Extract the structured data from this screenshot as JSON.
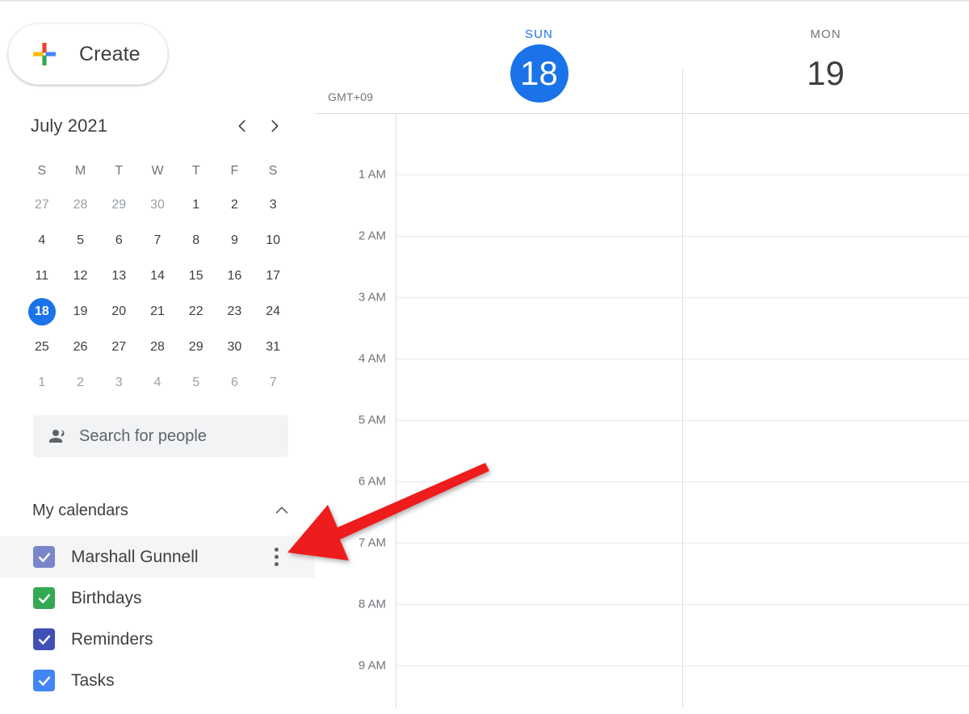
{
  "sidebar": {
    "create_button": {
      "label": "Create",
      "icon": "google-plus-multicolor-icon",
      "colors": {
        "red": "#ea4335",
        "yellow": "#fbbc04",
        "blue": "#4285f4",
        "green": "#34a853"
      }
    },
    "mini_calendar": {
      "title": "July 2021",
      "prev_icon": "chevron-left-icon",
      "next_icon": "chevron-right-icon",
      "weekday_initials": [
        "S",
        "M",
        "T",
        "W",
        "T",
        "F",
        "S"
      ],
      "today": 18,
      "weeks": [
        [
          {
            "n": "27",
            "muted": true
          },
          {
            "n": "28",
            "muted": true
          },
          {
            "n": "29",
            "muted": true
          },
          {
            "n": "30",
            "muted": true
          },
          {
            "n": "1",
            "muted": false
          },
          {
            "n": "2",
            "muted": false
          },
          {
            "n": "3",
            "muted": false
          }
        ],
        [
          {
            "n": "4",
            "muted": false
          },
          {
            "n": "5",
            "muted": false
          },
          {
            "n": "6",
            "muted": false
          },
          {
            "n": "7",
            "muted": false
          },
          {
            "n": "8",
            "muted": false
          },
          {
            "n": "9",
            "muted": false
          },
          {
            "n": "10",
            "muted": false
          }
        ],
        [
          {
            "n": "11",
            "muted": false
          },
          {
            "n": "12",
            "muted": false
          },
          {
            "n": "13",
            "muted": false
          },
          {
            "n": "14",
            "muted": false
          },
          {
            "n": "15",
            "muted": false
          },
          {
            "n": "16",
            "muted": false
          },
          {
            "n": "17",
            "muted": false
          }
        ],
        [
          {
            "n": "18",
            "muted": false,
            "today": true
          },
          {
            "n": "19",
            "muted": false
          },
          {
            "n": "20",
            "muted": false
          },
          {
            "n": "21",
            "muted": false
          },
          {
            "n": "22",
            "muted": false
          },
          {
            "n": "23",
            "muted": false
          },
          {
            "n": "24",
            "muted": false
          }
        ],
        [
          {
            "n": "25",
            "muted": false
          },
          {
            "n": "26",
            "muted": false
          },
          {
            "n": "27",
            "muted": false
          },
          {
            "n": "28",
            "muted": false
          },
          {
            "n": "29",
            "muted": false
          },
          {
            "n": "30",
            "muted": false
          },
          {
            "n": "31",
            "muted": false
          }
        ],
        [
          {
            "n": "1",
            "muted": true
          },
          {
            "n": "2",
            "muted": true
          },
          {
            "n": "3",
            "muted": true
          },
          {
            "n": "4",
            "muted": true
          },
          {
            "n": "5",
            "muted": true
          },
          {
            "n": "6",
            "muted": true
          },
          {
            "n": "7",
            "muted": true
          }
        ]
      ]
    },
    "people_search": {
      "placeholder": "Search for people",
      "value": "",
      "icon": "people-icon"
    },
    "my_calendars": {
      "title": "My calendars",
      "collapse_icon": "chevron-up-icon",
      "expanded": true,
      "items": [
        {
          "label": "Marshall Gunnell",
          "color": "#7986cb",
          "checked": true,
          "hovered": true,
          "has_menu": true
        },
        {
          "label": "Birthdays",
          "color": "#34a853",
          "checked": true,
          "hovered": false,
          "has_menu": false
        },
        {
          "label": "Reminders",
          "color": "#3f51b5",
          "checked": true,
          "hovered": false,
          "has_menu": false
        },
        {
          "label": "Tasks",
          "color": "#4285f4",
          "checked": true,
          "hovered": false,
          "has_menu": false
        }
      ]
    }
  },
  "calendar_grid": {
    "timezone_label": "GMT+09",
    "days": [
      {
        "name": "SUN",
        "number": "18",
        "today": true
      },
      {
        "name": "MON",
        "number": "19",
        "today": false
      }
    ],
    "hour_labels": [
      "1 AM",
      "2 AM",
      "3 AM",
      "4 AM",
      "5 AM",
      "6 AM",
      "7 AM",
      "8 AM",
      "9 AM"
    ]
  },
  "annotation": {
    "arrow_color": "#ee1c1c",
    "points_at": "calendar-options-menu"
  },
  "theme": {
    "accent_blue": "#1a73e8",
    "text_primary": "#3c4043",
    "text_secondary": "#70757a",
    "border": "#dadce0",
    "hover_bg": "#f5f5f5"
  }
}
